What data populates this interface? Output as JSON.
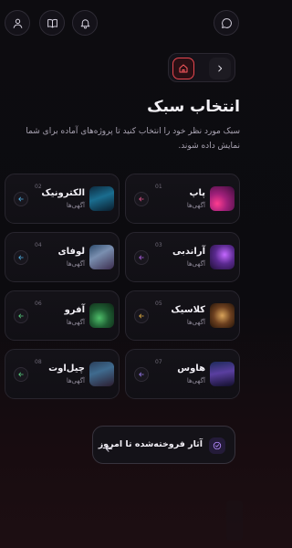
{
  "header": {
    "title": "انتخاب سبک",
    "description": "سبک مورد نظر خود را انتخاب کنید تا پروژه‌های آماده برای شما نمایش داده شوند."
  },
  "genres": [
    {
      "number": "01",
      "title": "پاپ",
      "subtitle": "آگهی‌ها",
      "accent": "#e2548b"
    },
    {
      "number": "02",
      "title": "الکترونیک",
      "subtitle": "آگهی‌ها",
      "accent": "#4fb3e8"
    },
    {
      "number": "03",
      "title": "آراندبی",
      "subtitle": "آگهی‌ها",
      "accent": "#b062e8"
    },
    {
      "number": "04",
      "title": "لوفای",
      "subtitle": "آگهی‌ها",
      "accent": "#4fb3e8"
    },
    {
      "number": "05",
      "title": "کلاسیک",
      "subtitle": "آگهی‌ها",
      "accent": "#e6b243"
    },
    {
      "number": "06",
      "title": "آفرو",
      "subtitle": "آگهی‌ها",
      "accent": "#58d17f"
    },
    {
      "number": "07",
      "title": "هاوس",
      "subtitle": "آگهی‌ها",
      "accent": "#9a7cf0"
    },
    {
      "number": "08",
      "title": "چیل‌اوت",
      "subtitle": "آگهی‌ها",
      "accent": "#58d17f"
    }
  ],
  "cta": {
    "label": "آثار فروخته‌شده تا امروز"
  },
  "icons": {
    "user": "user-icon",
    "book": "book-icon",
    "bell": "bell-icon",
    "chat": "chat-icon",
    "home": "home-icon",
    "forward": "chevron-right-icon",
    "arrow": "arrow-left-icon",
    "check": "check-circle-icon"
  },
  "colors": {
    "brand_red": "#ff5a5f",
    "purple": "#b78cff",
    "background": "#0d0c10"
  }
}
